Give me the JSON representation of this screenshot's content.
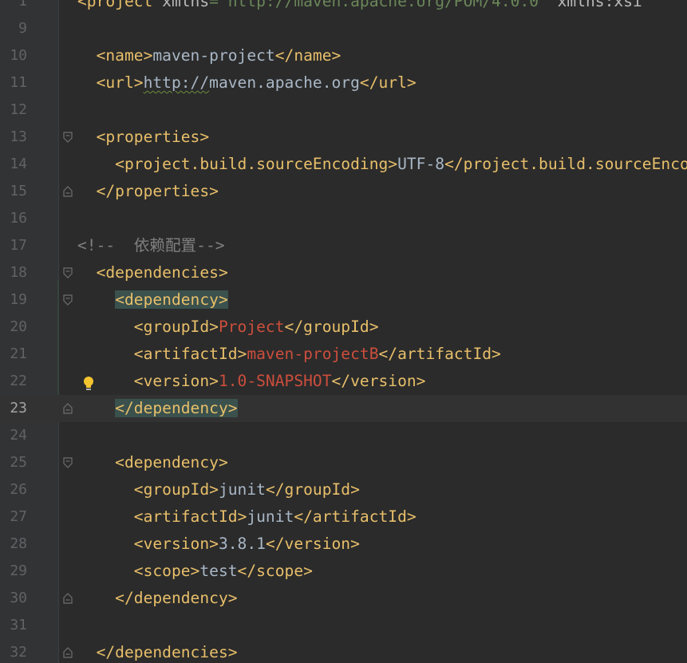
{
  "editor": {
    "lines": [
      {
        "n": "1",
        "parts": [
          {
            "c": "t",
            "s": "<project "
          },
          {
            "c": "x",
            "s": "xmlns"
          },
          {
            "c": "g",
            "s": "=\"http://maven.apache.org/POM/4.0.0\" "
          },
          {
            "c": "x",
            "s": "xmlns:xsi"
          }
        ]
      },
      {
        "n": "9",
        "parts": []
      },
      {
        "n": "10",
        "parts": [
          {
            "c": "t",
            "s": "  <name>"
          },
          {
            "c": "v",
            "s": "maven-project"
          },
          {
            "c": "t",
            "s": "</name>"
          }
        ]
      },
      {
        "n": "11",
        "parts": [
          {
            "c": "t",
            "s": "  <url>"
          },
          {
            "c": "v url",
            "s": "http://"
          },
          {
            "c": "v",
            "s": "maven.apache.org"
          },
          {
            "c": "t",
            "s": "</url>"
          }
        ]
      },
      {
        "n": "12",
        "parts": []
      },
      {
        "n": "13",
        "fold": "open",
        "parts": [
          {
            "c": "t",
            "s": "  <properties>"
          }
        ]
      },
      {
        "n": "14",
        "parts": [
          {
            "c": "t",
            "s": "    <project.build.sourceEncoding>"
          },
          {
            "c": "v",
            "s": "UTF-8"
          },
          {
            "c": "t",
            "s": "</project.build.sourceEncoding>"
          }
        ]
      },
      {
        "n": "15",
        "fold": "close",
        "parts": [
          {
            "c": "t",
            "s": "  </properties>"
          }
        ]
      },
      {
        "n": "16",
        "parts": []
      },
      {
        "n": "17",
        "parts": [
          {
            "c": "c",
            "s": "<!--  依赖配置-->"
          }
        ]
      },
      {
        "n": "18",
        "fold": "open",
        "parts": [
          {
            "c": "t",
            "s": "  <dependencies>"
          }
        ]
      },
      {
        "n": "19",
        "fold": "open",
        "parts": [
          {
            "c": "t",
            "s": "    "
          },
          {
            "c": "t hl",
            "s": "<dependency>"
          }
        ]
      },
      {
        "n": "20",
        "parts": [
          {
            "c": "t",
            "s": "      <groupId>"
          },
          {
            "c": "r",
            "s": "Project"
          },
          {
            "c": "t",
            "s": "</groupId>"
          }
        ]
      },
      {
        "n": "21",
        "parts": [
          {
            "c": "t",
            "s": "      <artifactId>"
          },
          {
            "c": "r",
            "s": "maven-projectB"
          },
          {
            "c": "t",
            "s": "</artifactId>"
          }
        ]
      },
      {
        "n": "22",
        "bulb": true,
        "parts": [
          {
            "c": "t",
            "s": "      <version>"
          },
          {
            "c": "r",
            "s": "1.0-SNAPSHOT"
          },
          {
            "c": "t",
            "s": "</version>"
          }
        ]
      },
      {
        "n": "23",
        "fold": "close",
        "current": true,
        "parts": [
          {
            "c": "t",
            "s": "    "
          },
          {
            "c": "t hl",
            "s": "</dependency>"
          }
        ]
      },
      {
        "n": "24",
        "parts": []
      },
      {
        "n": "25",
        "fold": "open",
        "parts": [
          {
            "c": "t",
            "s": "    <dependency>"
          }
        ]
      },
      {
        "n": "26",
        "parts": [
          {
            "c": "t",
            "s": "      <groupId>"
          },
          {
            "c": "v",
            "s": "junit"
          },
          {
            "c": "t",
            "s": "</groupId>"
          }
        ]
      },
      {
        "n": "27",
        "parts": [
          {
            "c": "t",
            "s": "      <artifactId>"
          },
          {
            "c": "v",
            "s": "junit"
          },
          {
            "c": "t",
            "s": "</artifactId>"
          }
        ]
      },
      {
        "n": "28",
        "parts": [
          {
            "c": "t",
            "s": "      <version>"
          },
          {
            "c": "v",
            "s": "3.8.1"
          },
          {
            "c": "t",
            "s": "</version>"
          }
        ]
      },
      {
        "n": "29",
        "parts": [
          {
            "c": "t",
            "s": "      <scope>"
          },
          {
            "c": "v",
            "s": "test"
          },
          {
            "c": "t",
            "s": "</scope>"
          }
        ]
      },
      {
        "n": "30",
        "fold": "close",
        "parts": [
          {
            "c": "t",
            "s": "    </dependency>"
          }
        ]
      },
      {
        "n": "31",
        "parts": []
      },
      {
        "n": "32",
        "fold": "close",
        "parts": [
          {
            "c": "t",
            "s": "  </dependencies>"
          }
        ]
      }
    ]
  },
  "colors": {
    "background": "#2b2b2b",
    "gutter": "#313335",
    "tag": "#e8bf6a",
    "text": "#a9b7c6",
    "value_red": "#cc4e3c",
    "string_green": "#6a8759",
    "comment": "#808080",
    "tag_highlight": "#3b514d"
  },
  "icons": {
    "fold_open": "fold-open-icon",
    "fold_close": "fold-close-icon",
    "intention": "lightbulb-icon"
  }
}
